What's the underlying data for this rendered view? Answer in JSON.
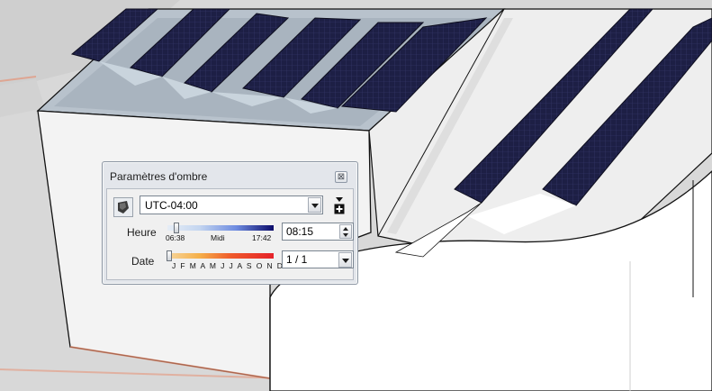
{
  "dialog": {
    "title": "Paramètres d'ombre",
    "close_label": "⊠",
    "timezone": {
      "value": "UTC-04:00",
      "icon": "globe-icon"
    },
    "add_button_icon": "plus-icon",
    "time": {
      "label": "Heure",
      "start_label": "06:38",
      "mid_label": "Midi",
      "end_label": "17:42",
      "value": "08:15",
      "slider_fraction": 0.07
    },
    "date": {
      "label": "Date",
      "months_label": "J F M A M J J A S O N D",
      "value": "1 / 1",
      "slider_fraction": 0.0
    }
  }
}
